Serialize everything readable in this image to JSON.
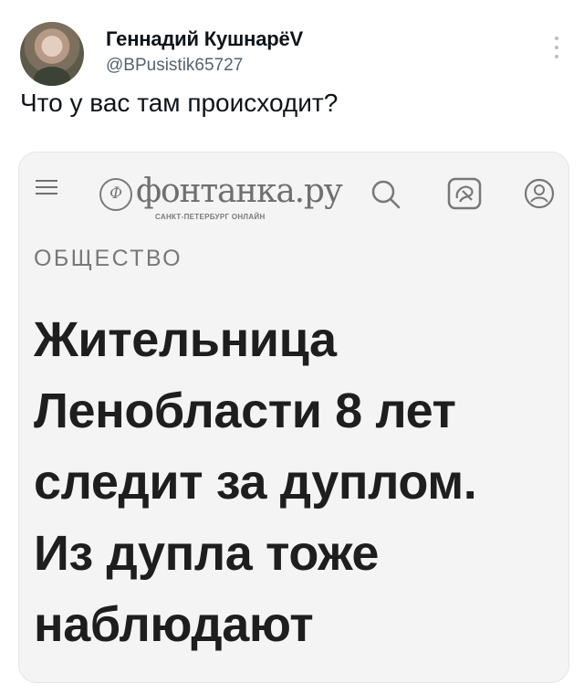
{
  "tweet": {
    "author_name": "Геннадий КушнарёV",
    "handle": "@BPusistik65727",
    "text": "Что у вас там происходит?"
  },
  "embedded_card": {
    "site": {
      "logo_text": "фонтанка.ру",
      "logo_subtitle": "САНКТ-ПЕТЕРБУРГ ОНЛАЙН",
      "logo_mark": "Ф"
    },
    "icons": [
      "burger-icon",
      "search-icon",
      "card-icon",
      "user-icon"
    ],
    "rubric": "ОБЩЕСТВО",
    "headline_lines": [
      "Жительница",
      "Ленобласти 8 лет",
      "следит за дуплом.",
      "Из дупла тоже",
      "наблюдают"
    ]
  },
  "colors": {
    "text": "#0f1419",
    "secondary_text": "#536471",
    "card_background": "#f4f4f4",
    "headline": "#1e1e1e"
  }
}
